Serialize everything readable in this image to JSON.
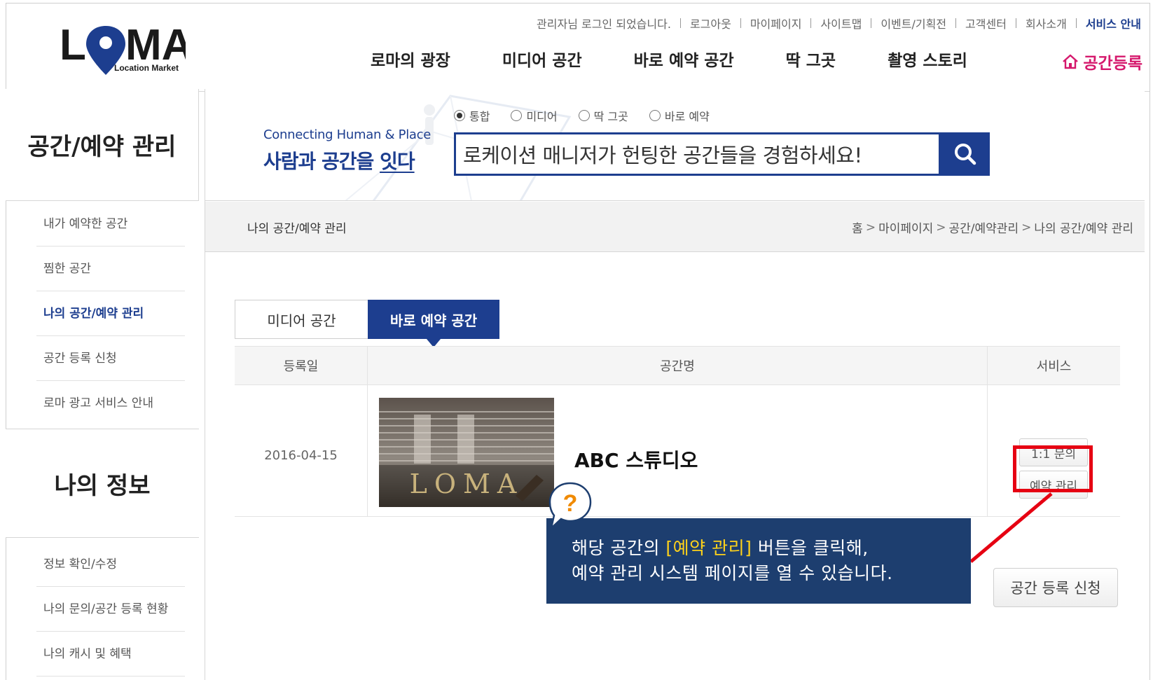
{
  "header": {
    "logo": {
      "text": "LOMA",
      "sub": "Location Market"
    },
    "util_links": [
      "관리자님 로그인 되었습니다.",
      "로그아웃",
      "마이페이지",
      "사이트맵",
      "이벤트/기획전",
      "고객센터",
      "회사소개"
    ],
    "service_link": "서비스 안내",
    "gnb": [
      "로마의 광장",
      "미디어 공간",
      "바로 예약 공간",
      "딱 그곳",
      "촬영 스토리"
    ],
    "register_label": "공간등록",
    "colors": {
      "brand": "#1d3e8f",
      "accent": "#d5186c"
    }
  },
  "sidebar": {
    "title": "공간/예약 관리",
    "items": [
      {
        "label": "내가 예약한 공간"
      },
      {
        "label": "찜한 공간"
      },
      {
        "label": "나의 공간/예약 관리"
      },
      {
        "label": "공간 등록 신청"
      },
      {
        "label": "로마 광고 서비스 안내"
      }
    ],
    "active_index": 2,
    "title2": "나의 정보",
    "items2": [
      {
        "label": "정보 확인/수정"
      },
      {
        "label": "나의 문의/공간 등록 현황"
      },
      {
        "label": "나의 캐시 및 혜택"
      }
    ]
  },
  "search": {
    "slogan_en": "Connecting Human & Place",
    "slogan_ko_prefix": "사람과 공간을 ",
    "slogan_ko_underline": "잇다",
    "options": [
      {
        "label": "통합",
        "checked": true
      },
      {
        "label": "미디어",
        "checked": false
      },
      {
        "label": "딱 그곳",
        "checked": false
      },
      {
        "label": "바로 예약",
        "checked": false
      }
    ],
    "placeholder": "로케이션 매니저가 헌팅한 공간들을 경험하세요!",
    "button_icon": "search-icon"
  },
  "location": {
    "title": "나의 공간/예약 관리",
    "breadcrumb": [
      "홈",
      "마이페이지",
      "공간/예약관리",
      "나의 공간/예약 관리"
    ]
  },
  "tabs": [
    {
      "label": "미디어 공간",
      "active": false
    },
    {
      "label": "바로 예약 공간",
      "active": true
    }
  ],
  "table": {
    "headers": [
      "등록일",
      "공간명",
      "서비스"
    ],
    "rows": [
      {
        "date": "2016-04-15",
        "thumbnail_text": "LOMA",
        "name": "ABC 스튜디오",
        "inquiry_label": "1:1 문의",
        "booking_label": "예약 관리"
      }
    ]
  },
  "apply_button": "공간 등록 신청",
  "callout": {
    "icon": "question-icon",
    "line1_prefix": "해당 공간의 ",
    "line1_highlight": "[예약 관리]",
    "line1_suffix": " 버튼을 클릭해,",
    "line2": "예약 관리 시스템 페이지를 열 수 있습니다.",
    "highlight_color": "#ffd21a",
    "pointer_color": "#e60012"
  }
}
